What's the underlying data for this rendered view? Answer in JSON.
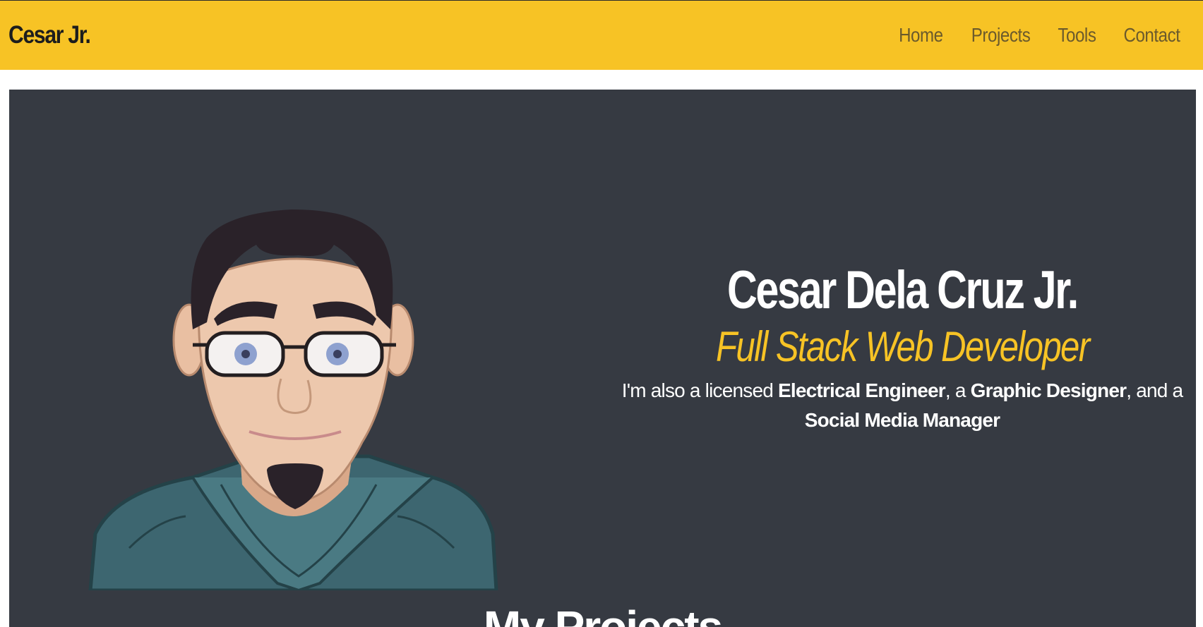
{
  "navbar": {
    "brand": "Cesar Jr.",
    "links": [
      {
        "label": "Home"
      },
      {
        "label": "Projects"
      },
      {
        "label": "Tools"
      },
      {
        "label": "Contact"
      }
    ]
  },
  "hero": {
    "name": "Cesar Dela Cruz Jr.",
    "role": "Full Stack Web Developer",
    "desc": {
      "prefix": "I'm also a licensed ",
      "role1": "Electrical Engineer",
      "sep1": ", a ",
      "role2": "Graphic Designer",
      "sep2": ", and a ",
      "role3": "Social Media Manager"
    },
    "avatar_icon": "cartoon-avatar"
  },
  "projects": {
    "title": "My Projects"
  },
  "colors": {
    "accent": "#f7c325",
    "hero_bg": "#363a42",
    "nav_link": "#6b5a2c"
  }
}
